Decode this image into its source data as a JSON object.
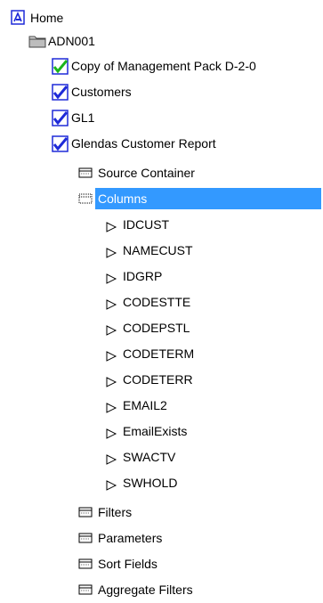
{
  "tree": {
    "root": {
      "label": "Home",
      "icon": "home-icon"
    },
    "folder": {
      "label": "ADN001",
      "icon": "folder-icon"
    },
    "reports": [
      {
        "label": "Copy of Management Pack D-2-0",
        "icon": "report-check-icon-green"
      },
      {
        "label": "Customers",
        "icon": "report-check-icon-blue"
      },
      {
        "label": "GL1",
        "icon": "report-check-icon-blue"
      },
      {
        "label": "Glendas Customer Report",
        "icon": "report-check-icon-blue"
      }
    ],
    "report_sections": {
      "source_container": "Source Container",
      "columns": "Columns",
      "filters": "Filters",
      "parameters": "Parameters",
      "sort_fields": "Sort Fields",
      "aggregate_filters": "Aggregate Filters"
    },
    "columns": [
      "IDCUST",
      "NAMECUST",
      "IDGRP",
      "CODESTTE",
      "CODEPSTL",
      "CODETERM",
      "CODETERR",
      "EMAIL2",
      "EmailExists",
      "SWACTV",
      "SWHOLD"
    ]
  },
  "colors": {
    "selection": "#3399ff",
    "folder": "#c8c8c8",
    "check_green": "#1bb51b",
    "check_blue": "#1e2ad8",
    "report_frame": "#1e2ad8"
  }
}
